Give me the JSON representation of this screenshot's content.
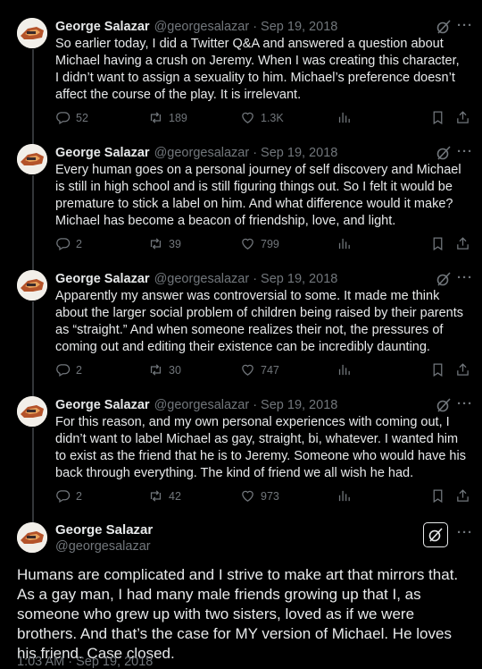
{
  "author": {
    "name": "George Salazar",
    "handle": "@georgesalazar"
  },
  "separator": "·",
  "more_label": "···",
  "thread": [
    {
      "date": "Sep 19, 2018",
      "text": "So earlier today, I did a Twitter Q&A and answered a question about Michael having a crush on Jeremy. When I was creating this character, I didn’t want to assign a sexuality to him. Michael’s preference doesn’t affect the course of the play. It is irrelevant.",
      "replies": "52",
      "retweets": "189",
      "likes": "1.3K"
    },
    {
      "date": "Sep 19, 2018",
      "text": "Every human goes on a personal journey of self discovery and Michael is still in high school and is still figuring things out. So I felt it would be premature to stick a label on him. And what difference would it make? Michael has become a beacon of friendship, love, and light.",
      "replies": "2",
      "retweets": "39",
      "likes": "799"
    },
    {
      "date": "Sep 19, 2018",
      "text": "Apparently my answer was controversial to some. It made me think about the larger social problem of children being raised by their parents as “straight.” And when someone realizes their not, the pressures of coming out and editing their existence can be incredibly daunting.",
      "replies": "2",
      "retweets": "30",
      "likes": "747"
    },
    {
      "date": "Sep 19, 2018",
      "text": "For this reason, and my own personal experiences with coming out, I didn’t want to label Michael as gay, straight, bi, whatever. I wanted him to exist as the friend that he is to Jeremy. Someone who would have his back through everything. The kind of friend we all wish he had.",
      "replies": "2",
      "retweets": "42",
      "likes": "973"
    }
  ],
  "main": {
    "text": "Humans are complicated and I strive to make art that mirrors that. As a gay man, I had many male friends growing up that I, as someone who grew up with two sisters, loved as if we were brothers. And that’s the case for MY version of Michael. He loves his friend. Case closed.",
    "timestamp": "1:03 AM · Sep 19, 2018"
  },
  "colors": {
    "background": "#000000",
    "text": "#e7e9ea",
    "muted": "#71767b",
    "line": "#333639"
  }
}
